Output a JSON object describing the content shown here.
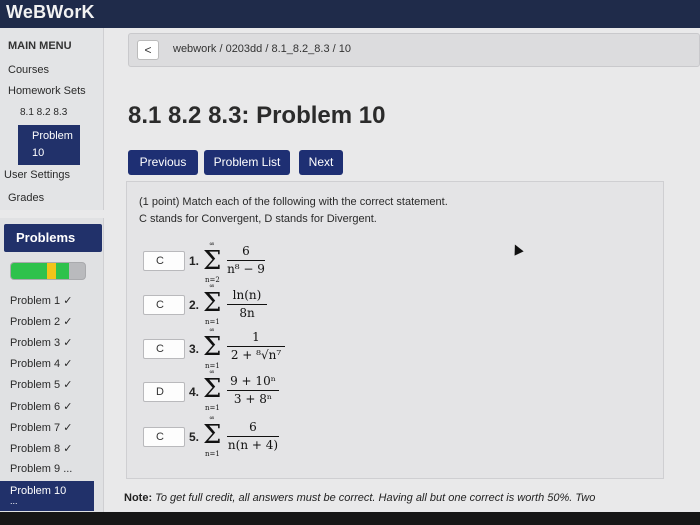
{
  "app": {
    "brand": "WeBWorK"
  },
  "sidebar": {
    "main_menu": "MAIN MENU",
    "courses": "Courses",
    "homework_sets": "Homework Sets",
    "set_name": "8.1 8.2 8.3",
    "problem_line1": "Problem",
    "problem_line2": "10",
    "user_settings": "User Settings",
    "grades": "Grades"
  },
  "problems_panel": {
    "header": "Problems",
    "progress_correct": 0.78,
    "progress_partial": 0.1,
    "items": [
      "Problem 1 ✓",
      "Problem 2 ✓",
      "Problem 3 ✓",
      "Problem 4 ✓",
      "Problem 5 ✓",
      "Problem 6 ✓",
      "Problem 7 ✓",
      "Problem 8 ✓",
      "Problem 9 ..."
    ],
    "current": "Problem 10",
    "current_sub": "..."
  },
  "breadcrumb": {
    "back": "<",
    "path": "webwork / 0203dd / 8.1_8.2_8.3 / 10"
  },
  "page": {
    "title": "8.1 8.2 8.3: Problem 10"
  },
  "buttons": {
    "previous": "Previous",
    "problem_list": "Problem List",
    "next": "Next"
  },
  "problem": {
    "intro_line1": "(1 point) Match each of the following with the correct statement.",
    "intro_line2": "C stands for Convergent, D stands for Divergent.",
    "items": [
      {
        "answer": "C",
        "num": "1.",
        "lower": "n=2",
        "upper": "∞",
        "numerator": "6",
        "denominator": "n⁸ − 9"
      },
      {
        "answer": "C",
        "num": "2.",
        "lower": "n=1",
        "upper": "∞",
        "numerator": "ln(n)",
        "denominator": "8n"
      },
      {
        "answer": "C",
        "num": "3.",
        "lower": "n=1",
        "upper": "∞",
        "numerator": "1",
        "denominator": "2 + ⁸√n⁷"
      },
      {
        "answer": "D",
        "num": "4.",
        "lower": "n=1",
        "upper": "∞",
        "numerator": "9 + 10ⁿ",
        "denominator": "3 + 8ⁿ"
      },
      {
        "answer": "C",
        "num": "5.",
        "lower": "n=1",
        "upper": "∞",
        "numerator": "6",
        "denominator": "n(n + 4)"
      }
    ],
    "sigma": "Σ"
  },
  "note": {
    "label": "Note:",
    "text": " To get full credit, all answers must be correct. Having all but one correct is worth 50%. Two"
  }
}
